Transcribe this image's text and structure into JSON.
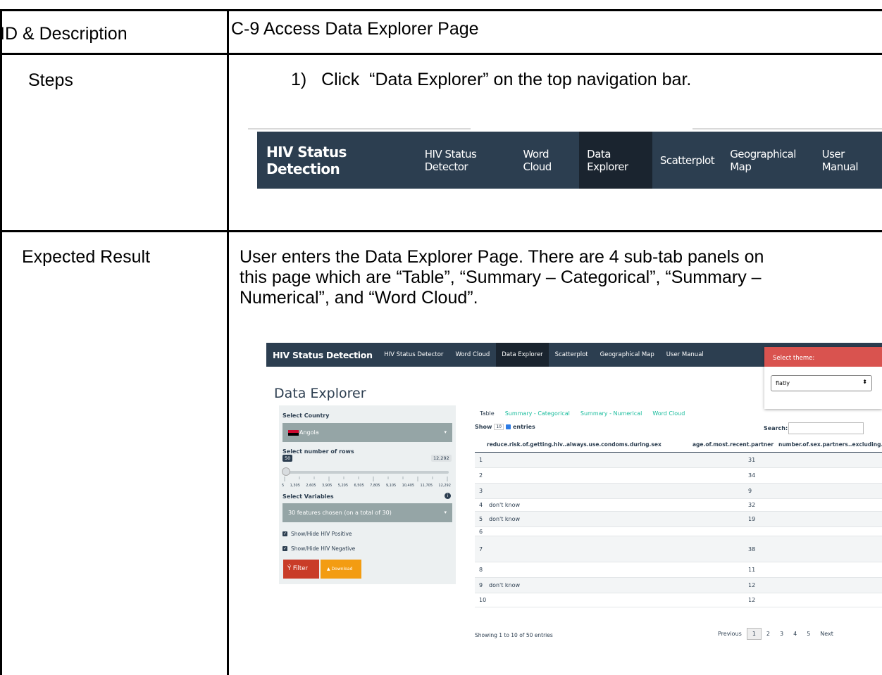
{
  "rows": {
    "id_label": "ID & Description",
    "id_value": "C-9 Access Data Explorer Page",
    "steps_label": "Steps",
    "steps_value": "1)   Click  “Data Explorer” on the top navigation bar.",
    "expected_label": "Expected Result",
    "expected_value_line1": "User enters the Data Explorer Page. There are 4 sub-tab panels on",
    "expected_value_line2": "this page which are “Table”, “Summary – Categorical”, “Summary –",
    "expected_value_line3": "Numerical”, and “Word Cloud”."
  },
  "nav": {
    "brand": "HIV Status Detection",
    "items": [
      "HIV Status Detector",
      "Word Cloud",
      "Data Explorer",
      "Scatterplot",
      "Geographical Map",
      "User Manual"
    ],
    "active_index": 2,
    "bg_color": "#2c3e50",
    "active_color": "#1a242f"
  },
  "explorer": {
    "title": "Data Explorer",
    "theme": {
      "header": "Select theme:",
      "value": "flatly",
      "arrow": "⬍"
    },
    "sidebar": {
      "country_label": "Select Country",
      "country_value": "Angola",
      "rows_label": "Select number of rows",
      "slider_min_badge": "50",
      "slider_max_badge": "12,292",
      "tick_labels": [
        "5",
        "1,305",
        "2,605",
        "3,905",
        "5,205",
        "6,505",
        "7,805",
        "9,105",
        "10,405",
        "11,705",
        "12,292"
      ],
      "variables_label": "Select Variables",
      "variables_value": "30 features chosen (on a total of 30)",
      "show_positive": "Show/Hide HIV Positive",
      "show_negative": "Show/Hide HIV Negative",
      "filter_label": "Filter",
      "download_label": "Download",
      "caret": "▾",
      "check_mark": "✓",
      "info": "i",
      "filter_icon": "Ỷ",
      "download_icon": "▲"
    },
    "tabs": [
      "Table",
      "Summary - Categorical",
      "Summary - Numerical",
      "Word Cloud"
    ],
    "show_label_pre": "Show",
    "show_count": "10",
    "show_label_post": "entries",
    "search_label": "Search:",
    "columns": [
      "reduce.risk.of.getting.hiv..always.use.condoms.during.sex",
      "age.of.most.recent.partner",
      "number.of.sex.partners..excluding.spo"
    ],
    "table_rows": [
      {
        "idx": "1",
        "c1": "",
        "c2": "31"
      },
      {
        "idx": "2",
        "c1": "",
        "c2": "34"
      },
      {
        "idx": "3",
        "c1": "",
        "c2": "9"
      },
      {
        "idx": "4",
        "c1": "don't know",
        "c2": "32"
      },
      {
        "idx": "5",
        "c1": "don't know",
        "c2": "19"
      },
      {
        "idx": "6",
        "c1": "",
        "c2": ""
      },
      {
        "idx": "7",
        "c1": "",
        "c2": "38"
      },
      {
        "idx": "8",
        "c1": "",
        "c2": "11"
      },
      {
        "idx": "9",
        "c1": "don't know",
        "c2": "12"
      },
      {
        "idx": "10",
        "c1": "",
        "c2": "12"
      }
    ],
    "info_text": "Showing 1 to 10 of 50 entries",
    "pager": [
      "Previous",
      "1",
      "2",
      "3",
      "4",
      "5",
      "Next"
    ],
    "pager_current": "1"
  }
}
